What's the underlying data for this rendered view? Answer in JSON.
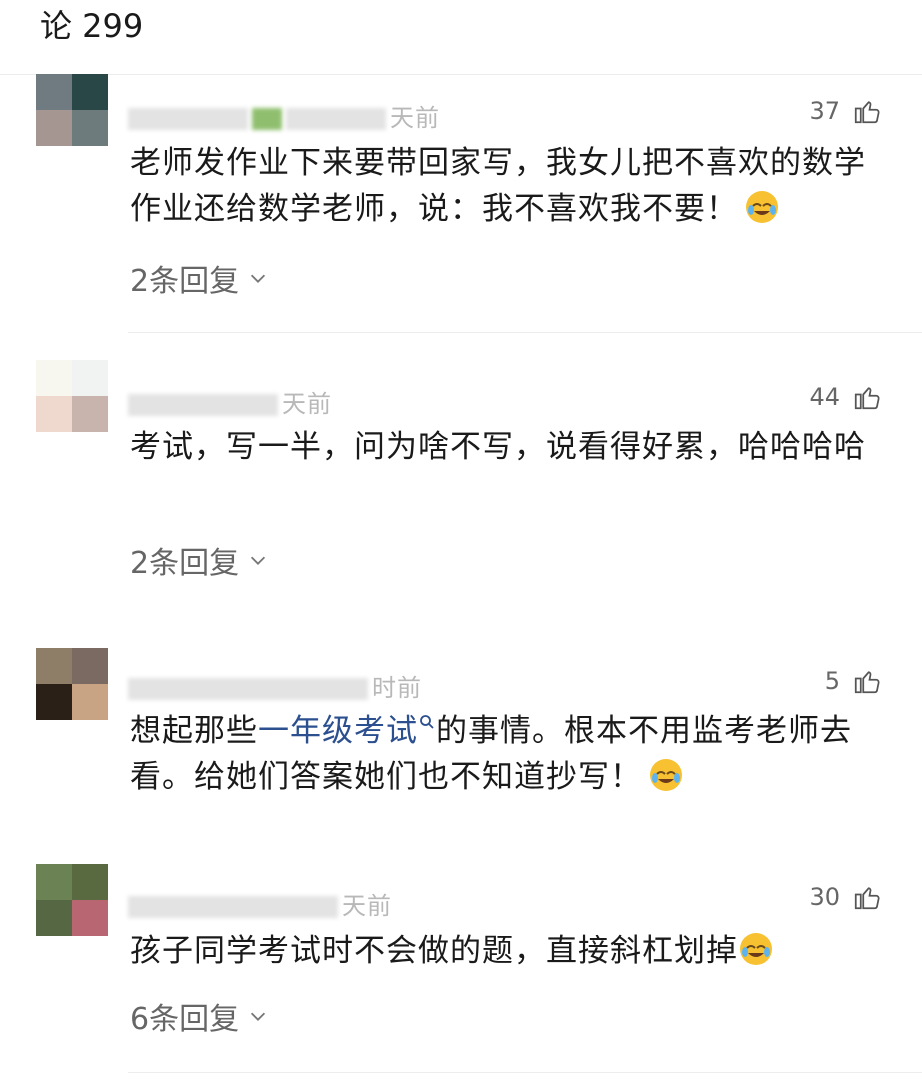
{
  "header": {
    "title": "论 299"
  },
  "comments": [
    {
      "time": "天前",
      "likes": "37",
      "text": "老师发作业下来要带回家写，我女儿把不喜欢的数学作业还给数学老师，说：我不喜欢我不要！",
      "replies": "2条回复",
      "avatar_colors": [
        "#6f7b80",
        "#2a4747",
        "#a69691",
        "#6e7b7d"
      ]
    },
    {
      "time": "天前",
      "likes": "44",
      "text": "考试，写一半，问为啥不写，说看得好累，哈哈哈哈",
      "replies": "2条回复",
      "avatar_colors": [
        "#f7f6ef",
        "#f1f3f2",
        "#efd9cf",
        "#c8b3ad"
      ]
    },
    {
      "time": "时前",
      "likes": "5",
      "text_before": "想起那些",
      "text_link": "一年级考试",
      "text_after": "的事情。根本不用监考老师去看。给她们答案她们也不知道抄写！",
      "avatar_colors": [
        "#8e7e68",
        "#7a6a62",
        "#2b2017",
        "#c8a384"
      ]
    },
    {
      "time": "天前",
      "likes": "30",
      "text": "孩子同学考试时不会做的题，直接斜杠划掉",
      "replies": "6条回复",
      "avatar_colors": [
        "#6b8255",
        "#5a6a40",
        "#566744",
        "#b86672"
      ]
    }
  ]
}
